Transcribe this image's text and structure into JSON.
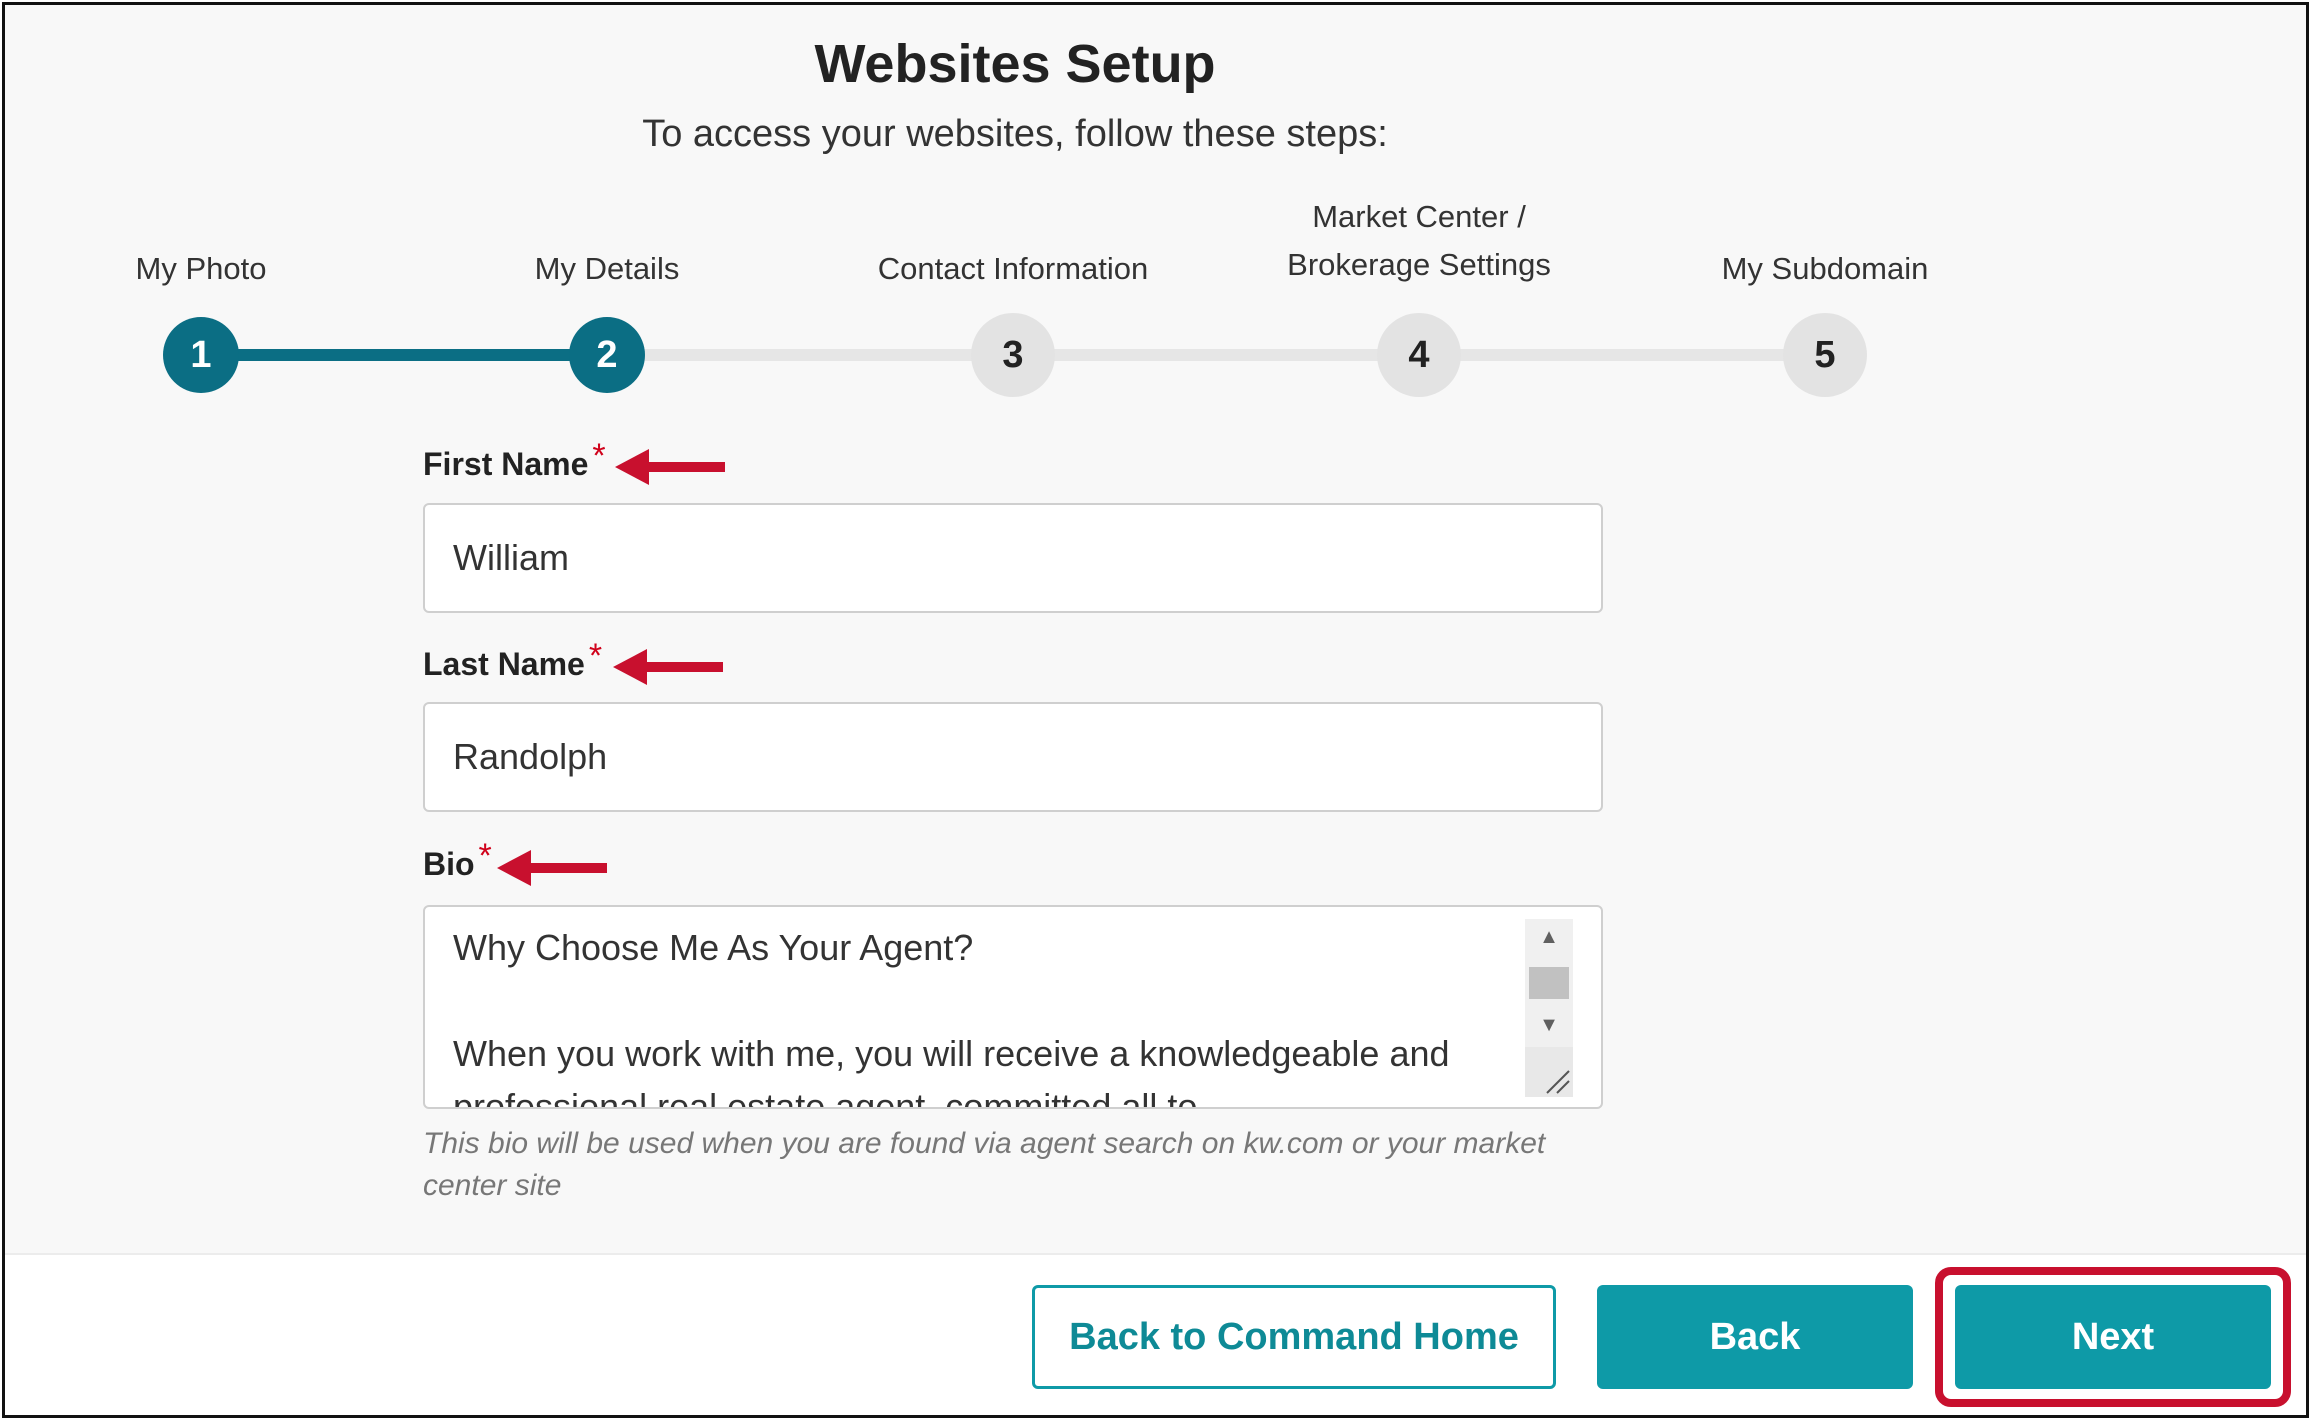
{
  "header": {
    "title": "Websites Setup",
    "subtitle": "To access your websites, follow these steps:"
  },
  "stepper": {
    "steps": [
      {
        "number": "1",
        "label_line1": "",
        "label_line2": "My Photo",
        "status": "complete"
      },
      {
        "number": "2",
        "label_line1": "",
        "label_line2": "My Details",
        "status": "current"
      },
      {
        "number": "3",
        "label_line1": "",
        "label_line2": "Contact Information",
        "status": "pending"
      },
      {
        "number": "4",
        "label_line1": "Market Center /",
        "label_line2": "Brokerage Settings",
        "status": "pending"
      },
      {
        "number": "5",
        "label_line1": "",
        "label_line2": "My Subdomain",
        "status": "pending"
      }
    ]
  },
  "form": {
    "first_name": {
      "label": "First Name",
      "required_mark": "*",
      "value": "William"
    },
    "last_name": {
      "label": "Last Name",
      "required_mark": "*",
      "value": "Randolph"
    },
    "bio": {
      "label": "Bio",
      "required_mark": "*",
      "value": "Why Choose Me As Your Agent?\n\nWhen you work with me, you will receive a knowledgeable and professional real estate agent, committed all to",
      "helper_text": "This bio will be used when you are found via agent search on kw.com or your market center site"
    }
  },
  "footer": {
    "back_to_command_label": "Back to Command Home",
    "back_label": "Back",
    "next_label": "Next"
  },
  "colors": {
    "primary_teal": "#0e9aa7",
    "step_active": "#0b6e84",
    "annotation_red": "#c8102e",
    "required_red": "#d0021b"
  },
  "annotations": {
    "arrow_icon": "left-arrow-icon",
    "highlight_target": "next-button"
  }
}
